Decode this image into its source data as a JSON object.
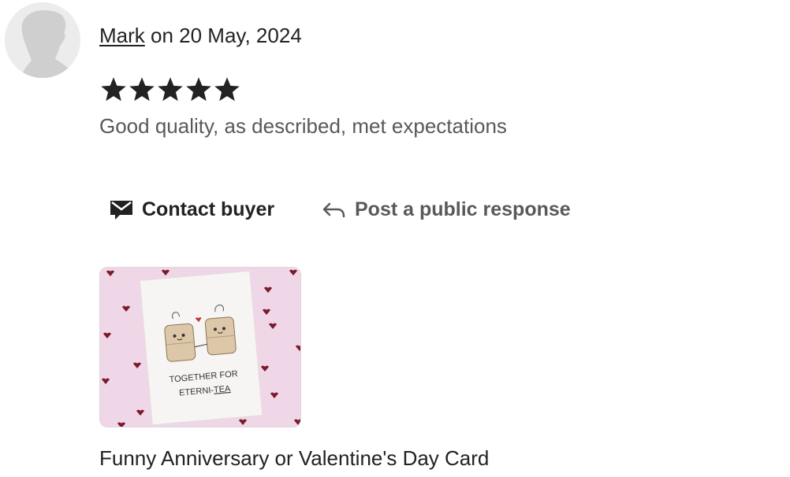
{
  "review": {
    "reviewer_name": "Mark",
    "date_prefix": " on ",
    "date": "20 May, 2024",
    "rating": 5,
    "rating_max": 5,
    "text": "Good quality, as described, met expectations"
  },
  "actions": {
    "contact_label": "Contact buyer",
    "contact_icon": "envelope-icon",
    "respond_label": "Post a public response",
    "respond_icon": "reply-arrow-icon"
  },
  "product": {
    "title": "Funny Anniversary or Valentine's Day Card",
    "card_text_line1": "TOGETHER FOR",
    "card_text_line2_prefix": "ETERNI-",
    "card_text_line2_underlined": "TEA"
  },
  "colors": {
    "thumb_background": "#efd7e7",
    "heart": "#7a1a2a",
    "text_primary": "#222222",
    "text_secondary": "#595959"
  }
}
